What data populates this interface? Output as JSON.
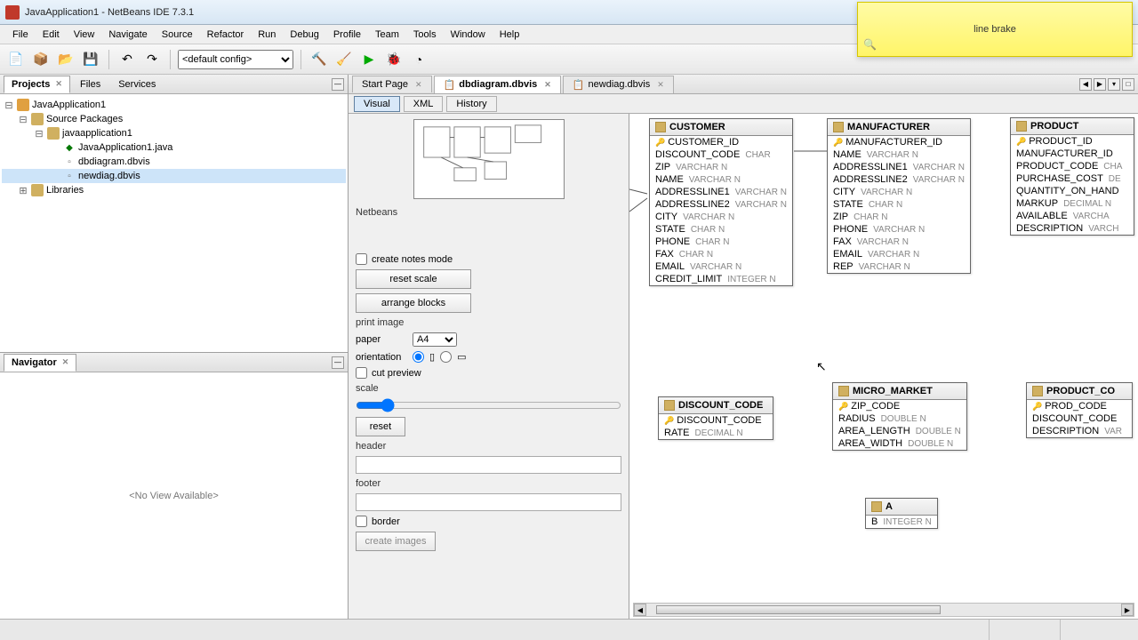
{
  "window": {
    "title": "JavaApplication1 - NetBeans IDE 7.3.1"
  },
  "menu": [
    "File",
    "Edit",
    "View",
    "Navigate",
    "Source",
    "Refactor",
    "Run",
    "Debug",
    "Profile",
    "Team",
    "Tools",
    "Window",
    "Help"
  ],
  "sticky": {
    "text": "line brake"
  },
  "toolbar": {
    "config_selected": "<default config>"
  },
  "left_tabs": {
    "projects": "Projects",
    "files": "Files",
    "services": "Services"
  },
  "tree": {
    "root": "JavaApplication1",
    "pkg_src": "Source Packages",
    "pkg": "javaapplication1",
    "java": "JavaApplication1.java",
    "db1": "dbdiagram.dbvis",
    "db2": "newdiag.dbvis",
    "lib": "Libraries"
  },
  "navigator": {
    "title": "Navigator",
    "empty": "<No View Available>"
  },
  "editor_tabs": {
    "start": "Start Page",
    "t1": "dbdiagram.dbvis",
    "t2": "newdiag.dbvis"
  },
  "sub_tabs": {
    "visual": "Visual",
    "xml": "XML",
    "history": "History"
  },
  "props": {
    "brand": "Netbeans",
    "create_notes": "create notes mode",
    "reset_scale": "reset scale",
    "arrange_blocks": "arrange blocks",
    "print_image": "print image",
    "paper": "paper",
    "paper_val": "A4",
    "orientation": "orientation",
    "cut_preview": "cut preview",
    "scale": "scale",
    "reset": "reset",
    "header": "header",
    "footer": "footer",
    "border": "border",
    "create_images": "create images"
  },
  "tables": {
    "customer": {
      "name": "CUSTOMER",
      "cols": [
        {
          "n": "CUSTOMER_ID",
          "t": "",
          "pk": true
        },
        {
          "n": "DISCOUNT_CODE",
          "t": "CHAR"
        },
        {
          "n": "ZIP",
          "t": "VARCHAR N"
        },
        {
          "n": "NAME",
          "t": "VARCHAR N"
        },
        {
          "n": "ADDRESSLINE1",
          "t": "VARCHAR N"
        },
        {
          "n": "ADDRESSLINE2",
          "t": "VARCHAR N"
        },
        {
          "n": "CITY",
          "t": "VARCHAR N"
        },
        {
          "n": "STATE",
          "t": "CHAR N"
        },
        {
          "n": "PHONE",
          "t": "CHAR N"
        },
        {
          "n": "FAX",
          "t": "CHAR N"
        },
        {
          "n": "EMAIL",
          "t": "VARCHAR N"
        },
        {
          "n": "CREDIT_LIMIT",
          "t": "INTEGER N"
        }
      ]
    },
    "manufacturer": {
      "name": "MANUFACTURER",
      "cols": [
        {
          "n": "MANUFACTURER_ID",
          "t": "",
          "pk": true
        },
        {
          "n": "NAME",
          "t": "VARCHAR N"
        },
        {
          "n": "ADDRESSLINE1",
          "t": "VARCHAR N"
        },
        {
          "n": "ADDRESSLINE2",
          "t": "VARCHAR N"
        },
        {
          "n": "CITY",
          "t": "VARCHAR N"
        },
        {
          "n": "STATE",
          "t": "CHAR N"
        },
        {
          "n": "ZIP",
          "t": "CHAR N"
        },
        {
          "n": "PHONE",
          "t": "VARCHAR N"
        },
        {
          "n": "FAX",
          "t": "VARCHAR N"
        },
        {
          "n": "EMAIL",
          "t": "VARCHAR N"
        },
        {
          "n": "REP",
          "t": "VARCHAR N"
        }
      ]
    },
    "product": {
      "name": "PRODUCT",
      "cols": [
        {
          "n": "PRODUCT_ID",
          "t": "",
          "pk": true
        },
        {
          "n": "MANUFACTURER_ID",
          "t": ""
        },
        {
          "n": "PRODUCT_CODE",
          "t": "CHA"
        },
        {
          "n": "PURCHASE_COST",
          "t": "DE"
        },
        {
          "n": "QUANTITY_ON_HAND",
          "t": ""
        },
        {
          "n": "MARKUP",
          "t": "DECIMAL N"
        },
        {
          "n": "AVAILABLE",
          "t": "VARCHA"
        },
        {
          "n": "DESCRIPTION",
          "t": "VARCH"
        }
      ]
    },
    "discount": {
      "name": "DISCOUNT_CODE",
      "cols": [
        {
          "n": "DISCOUNT_CODE",
          "t": "",
          "pk": true
        },
        {
          "n": "RATE",
          "t": "DECIMAL N"
        }
      ]
    },
    "micro": {
      "name": "MICRO_MARKET",
      "cols": [
        {
          "n": "ZIP_CODE",
          "t": "",
          "pk": true
        },
        {
          "n": "RADIUS",
          "t": "DOUBLE N"
        },
        {
          "n": "AREA_LENGTH",
          "t": "DOUBLE N"
        },
        {
          "n": "AREA_WIDTH",
          "t": "DOUBLE N"
        }
      ]
    },
    "a": {
      "name": "A",
      "cols": [
        {
          "n": "B",
          "t": "INTEGER N"
        }
      ]
    },
    "prodcode": {
      "name": "PRODUCT_CO",
      "cols": [
        {
          "n": "PROD_CODE",
          "t": "",
          "pk": true
        },
        {
          "n": "DISCOUNT_CODE",
          "t": ""
        },
        {
          "n": "DESCRIPTION",
          "t": "VAR"
        }
      ]
    }
  }
}
